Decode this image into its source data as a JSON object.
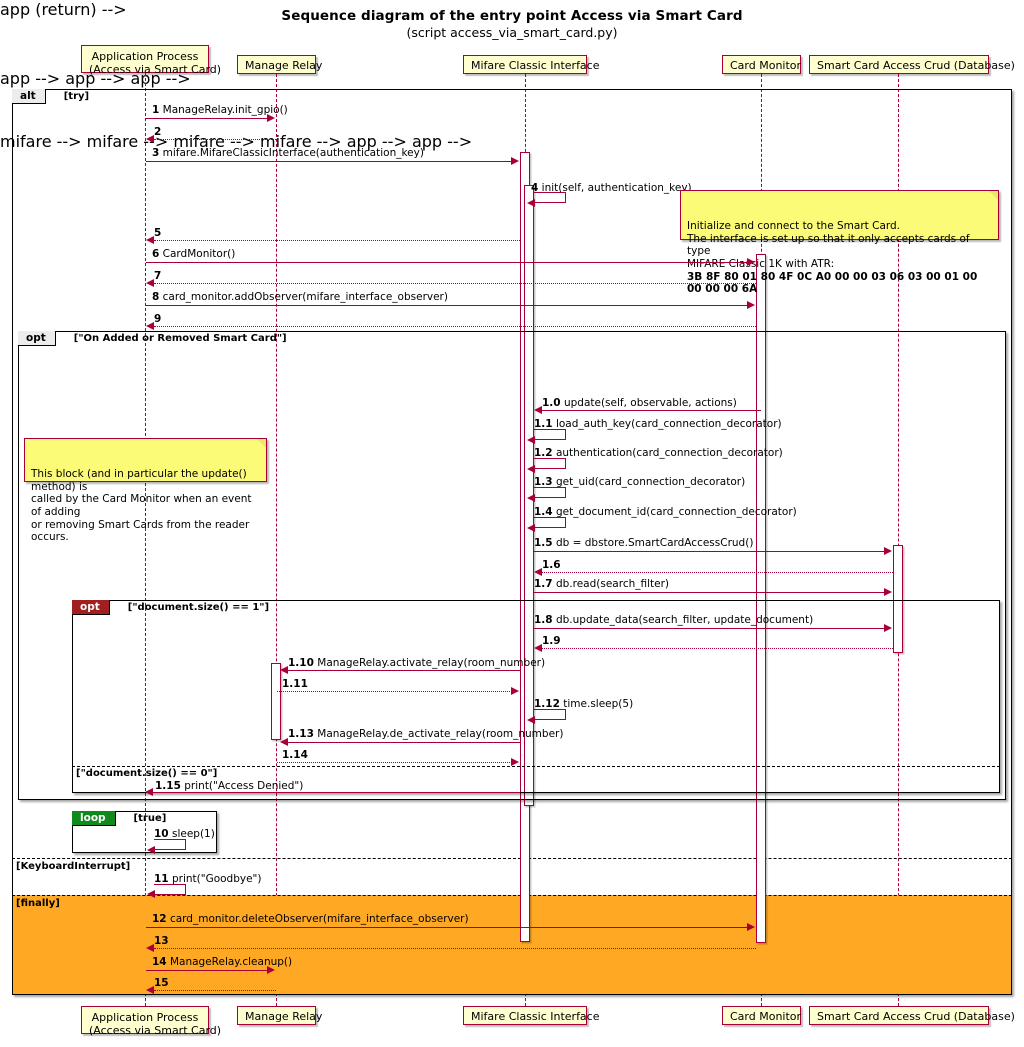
{
  "diagram": {
    "title": "Sequence diagram of the entry point Access via Smart Card",
    "subtitle": "(script access_via_smart_card.py)"
  },
  "participants": [
    {
      "id": "app",
      "label": "Application Process\n(Access via Smart Card)",
      "line1": "Application Process",
      "line2": "(Access via Smart Card)"
    },
    {
      "id": "relay",
      "label": "Manage Relay"
    },
    {
      "id": "mifare",
      "label": "Mifare Classic Interface"
    },
    {
      "id": "monitor",
      "label": "Card Monitor"
    },
    {
      "id": "db",
      "label": "Smart Card Access Crud (Database)"
    }
  ],
  "fragments": {
    "alt": {
      "tag": "alt",
      "cond": "[try]"
    },
    "alt_else1": {
      "cond": "[KeyboardInterrupt]"
    },
    "alt_else2": {
      "cond": "[finally]"
    },
    "opt_outer": {
      "tag": "opt",
      "cond": "[\"On Added or Removed Smart Card\"]"
    },
    "opt_inner": {
      "tag": "opt",
      "cond": "[\"document.size() == 1\"]"
    },
    "opt_inner_else": {
      "cond": "[\"document.size() == 0\"]"
    },
    "loop": {
      "tag": "loop",
      "cond": "[true]"
    }
  },
  "notes": [
    {
      "id": "note-smart-card-init",
      "text": "Initialize and connect to the Smart Card.\nThe interface is set up so that it only accepts cards of type\nMIFARE Classic 1K with ATR:",
      "bold_line": "3B 8F 80 01 80 4F 0C A0 00 00 03 06 03 00 01 00 00 00 00 6A"
    },
    {
      "id": "note-update-block",
      "text": "This block (and in particular the update() method) is\ncalled by the Card Monitor when an event of adding\nor removing Smart Cards from the reader occurs."
    }
  ],
  "messages": [
    {
      "num": "1",
      "text": "ManageRelay.init_gpio()"
    },
    {
      "num": "2",
      "text": ""
    },
    {
      "num": "3",
      "text": "mifare.MifareClassicInterface(authentication_key)"
    },
    {
      "num": "4",
      "text": "init(self, authentication_key)",
      "underline_first": "init"
    },
    {
      "num": "5",
      "text": ""
    },
    {
      "num": "6",
      "text": "CardMonitor()"
    },
    {
      "num": "7",
      "text": ""
    },
    {
      "num": "8",
      "text": "card_monitor.addObserver(mifare_interface_observer)"
    },
    {
      "num": "9",
      "text": ""
    },
    {
      "num": "1.0",
      "text": "update(self, observable, actions)"
    },
    {
      "num": "1.1",
      "text": "load_auth_key(card_connection_decorator)"
    },
    {
      "num": "1.2",
      "text": "authentication(card_connection_decorator)"
    },
    {
      "num": "1.3",
      "text": "get_uid(card_connection_decorator)"
    },
    {
      "num": "1.4",
      "text": "get_document_id(card_connection_decorator)"
    },
    {
      "num": "1.5",
      "text": "db = dbstore.SmartCardAccessCrud()"
    },
    {
      "num": "1.6",
      "text": ""
    },
    {
      "num": "1.7",
      "text": "db.read(search_filter)"
    },
    {
      "num": "1.8",
      "text": "db.update_data(search_filter, update_document)"
    },
    {
      "num": "1.9",
      "text": ""
    },
    {
      "num": "1.10",
      "text": "ManageRelay.activate_relay(room_number)"
    },
    {
      "num": "1.11",
      "text": ""
    },
    {
      "num": "1.12",
      "text": "time.sleep(5)"
    },
    {
      "num": "1.13",
      "text": "ManageRelay.de_activate_relay(room_number)"
    },
    {
      "num": "1.14",
      "text": ""
    },
    {
      "num": "1.15",
      "text": "print(\"Access Denied\")"
    },
    {
      "num": "10",
      "text": "sleep(1)"
    },
    {
      "num": "11",
      "text": "print(\"Goodbye\")"
    },
    {
      "num": "12",
      "text": "card_monitor.deleteObserver(mifare_interface_observer)"
    },
    {
      "num": "13",
      "text": ""
    },
    {
      "num": "14",
      "text": "ManageRelay.cleanup()"
    },
    {
      "num": "15",
      "text": ""
    }
  ],
  "colors": {
    "accent": "#A80036",
    "participant_fill": "#FEFECE",
    "note_fill": "#FBFB77",
    "finally_fill": "#FFA823",
    "loop_tag": "#0F8B1E",
    "opt_inner_tag": "#A02020",
    "frag_tag": "#ECECEC"
  }
}
